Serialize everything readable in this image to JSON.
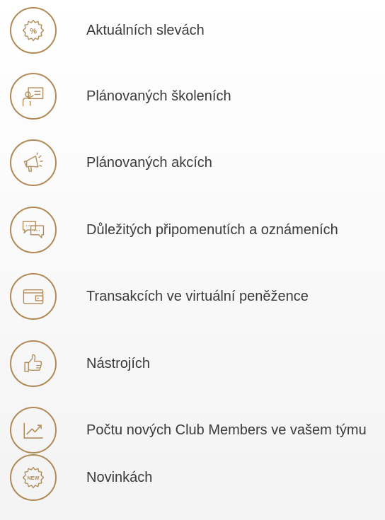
{
  "items": [
    {
      "label": "Aktuálních slevách",
      "icon": "discount-icon"
    },
    {
      "label": "Plánovaných školeních",
      "icon": "training-icon"
    },
    {
      "label": "Plánovaných akcích",
      "icon": "megaphone-icon"
    },
    {
      "label": "Důležitých připomenutích a oznámeních",
      "icon": "chat-bubbles-icon"
    },
    {
      "label": "Transakcích ve virtuální peněžence",
      "icon": "wallet-icon"
    },
    {
      "label": "Nástrojích",
      "icon": "thumbs-up-icon"
    },
    {
      "label": "Počtu nových Club Members ve vašem týmu",
      "icon": "growth-chart-icon"
    },
    {
      "label": "Novinkách",
      "icon": "new-badge-icon"
    }
  ],
  "colors": {
    "accent": "#b08b57",
    "text": "#3a3a3a",
    "background": "#ffffff"
  }
}
